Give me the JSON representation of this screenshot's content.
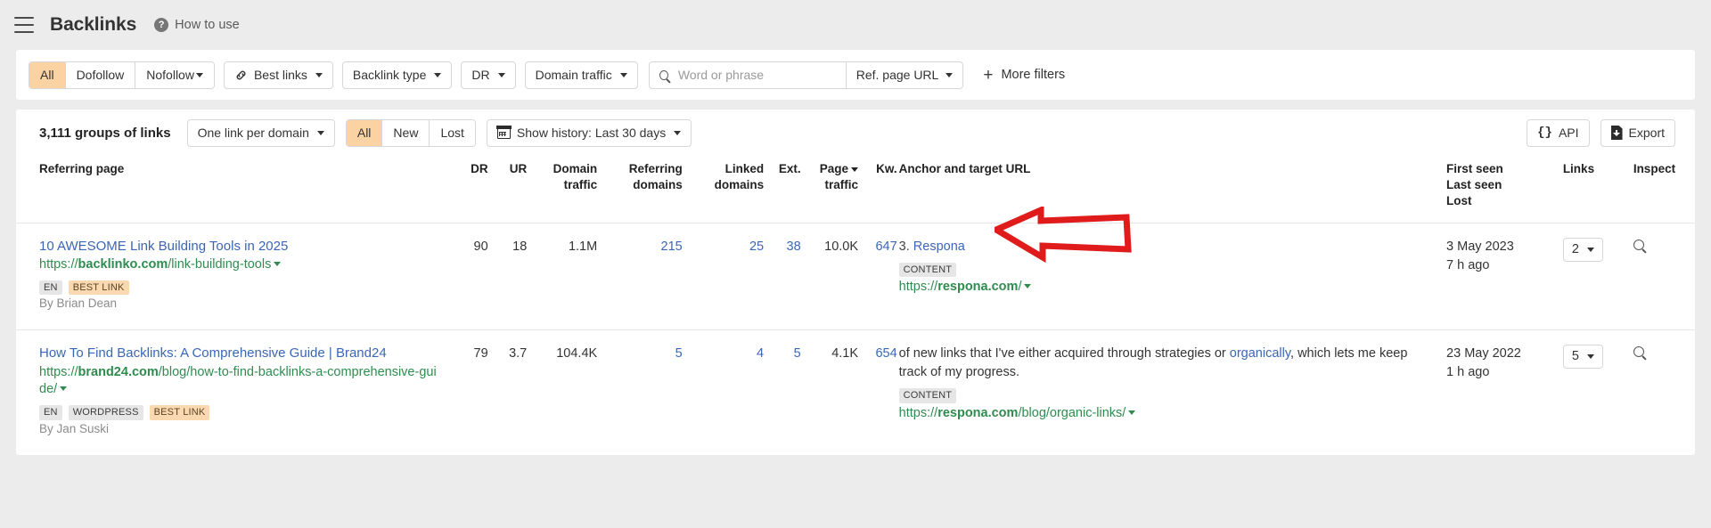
{
  "header": {
    "menu_icon": "hamburger-icon",
    "title": "Backlinks",
    "help_icon": "question-mark-icon",
    "help_label": "How to use"
  },
  "filters": {
    "follow_segment": [
      "All",
      "Dofollow",
      "Nofollow"
    ],
    "follow_active": "All",
    "best_links": "Best links",
    "backlink_type": "Backlink type",
    "dr": "DR",
    "domain_traffic": "Domain traffic",
    "search_value": "",
    "search_placeholder": "Word or phrase",
    "ref_page_url": "Ref. page URL",
    "more_filters": "More filters"
  },
  "toolbar": {
    "groups_count": "3,111 groups of links",
    "grouping": "One link per domain",
    "status_segment": [
      "All",
      "New",
      "Lost"
    ],
    "status_active": "All",
    "show_history": "Show history: Last 30 days",
    "api": "API",
    "export": "Export"
  },
  "table": {
    "columns": {
      "referring_page": "Referring page",
      "dr": "DR",
      "ur": "UR",
      "domain_traffic_1": "Domain",
      "domain_traffic_2": "traffic",
      "referring_domains_1": "Referring",
      "referring_domains_2": "domains",
      "linked_domains_1": "Linked",
      "linked_domains_2": "domains",
      "ext": "Ext.",
      "page_traffic_1": "Page",
      "page_traffic_2": "traffic",
      "kw": "Kw.",
      "anchor_and_target": "Anchor and target URL",
      "first_seen": "First seen",
      "last_seen": "Last seen",
      "lost": "Lost",
      "links": "Links",
      "inspect": "Inspect"
    },
    "sorted_column": "page_traffic",
    "rows": [
      {
        "title": "10 AWESOME Link Building Tools in 2025",
        "url_scheme": "https://",
        "url_domain": "backlinko.com",
        "url_path": "/link-building-tools",
        "tags": [
          "EN",
          "BEST LINK"
        ],
        "byline": "By Brian Dean",
        "dr": "90",
        "ur": "18",
        "domain_traffic": "1.1M",
        "referring_domains": "215",
        "linked_domains": "25",
        "ext": "38",
        "page_traffic": "10.0K",
        "kw": "647",
        "anchor_prefix": "3.",
        "anchor_link": "Respona",
        "anchor_suffix": "",
        "anchor_tag": "CONTENT",
        "target_scheme": "https://",
        "target_domain": "respona.com",
        "target_path": "/",
        "first_seen": "3 May 2023",
        "last_seen": "7 h ago",
        "links": "2"
      },
      {
        "title": "How To Find Backlinks: A Comprehensive Guide | Brand24",
        "url_scheme": "https://",
        "url_domain": "brand24.com",
        "url_path": "/blog/how-to-find-backlinks-a-comprehensive-guide/",
        "tags": [
          "EN",
          "WORDPRESS",
          "BEST LINK"
        ],
        "byline": "By Jan Suski",
        "dr": "79",
        "ur": "3.7",
        "domain_traffic": "104.4K",
        "referring_domains": "5",
        "linked_domains": "4",
        "ext": "5",
        "page_traffic": "4.1K",
        "kw": "654",
        "anchor_prefix": "of new links that I've either acquired through strategies or",
        "anchor_link": "organically",
        "anchor_suffix": ", which lets me keep track of my progress.",
        "anchor_tag": "CONTENT",
        "target_scheme": "https://",
        "target_domain": "respona.com",
        "target_path": "/blog/organic-links/",
        "first_seen": "23 May 2022",
        "last_seen": "1 h ago",
        "links": "5"
      }
    ]
  },
  "annotation": {
    "arrow_color": "#e01b1b",
    "arrow_name": "red-callout-arrow"
  }
}
